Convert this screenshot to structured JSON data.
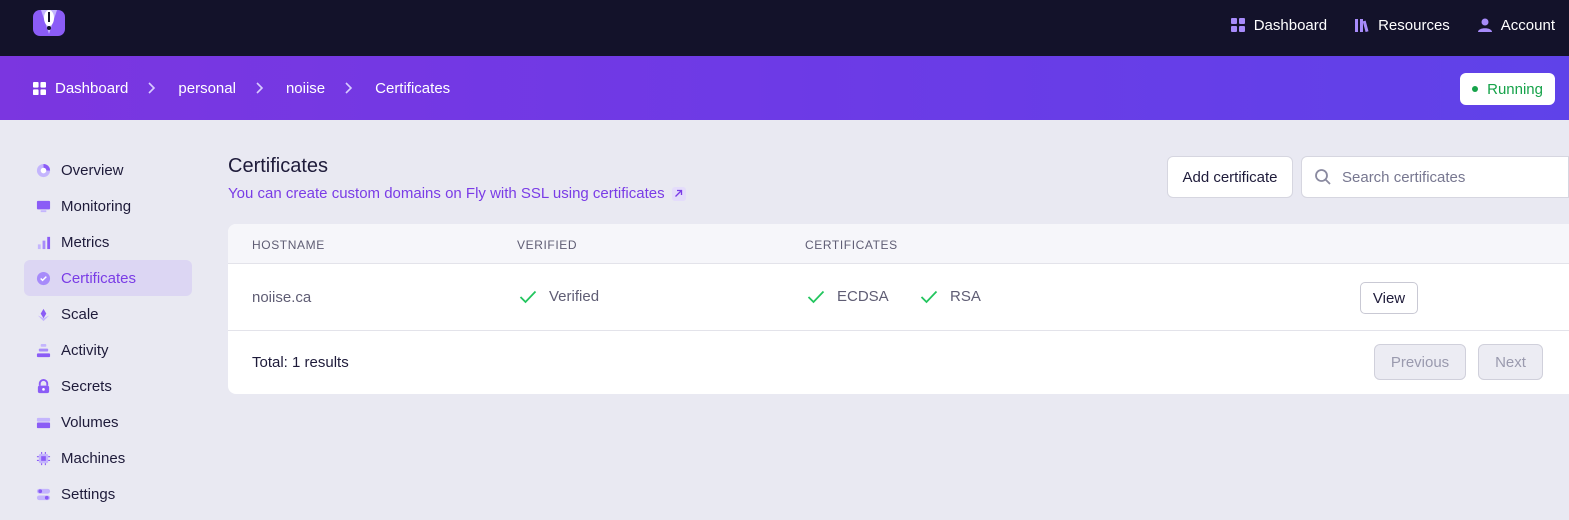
{
  "topnav": {
    "dashboard": "Dashboard",
    "resources": "Resources",
    "account": "Account"
  },
  "breadcrumb": {
    "items": [
      "Dashboard",
      "personal",
      "noiise",
      "Certificates"
    ]
  },
  "status": {
    "label": "Running",
    "color": "#16a34a"
  },
  "sidebar": {
    "items": [
      {
        "label": "Overview",
        "icon": "overview-icon"
      },
      {
        "label": "Monitoring",
        "icon": "monitor-icon"
      },
      {
        "label": "Metrics",
        "icon": "metrics-icon"
      },
      {
        "label": "Certificates",
        "icon": "certificate-icon",
        "active": true
      },
      {
        "label": "Scale",
        "icon": "scale-icon"
      },
      {
        "label": "Activity",
        "icon": "activity-icon"
      },
      {
        "label": "Secrets",
        "icon": "lock-icon"
      },
      {
        "label": "Volumes",
        "icon": "volume-icon"
      },
      {
        "label": "Machines",
        "icon": "chip-icon"
      },
      {
        "label": "Settings",
        "icon": "settings-icon"
      }
    ]
  },
  "main": {
    "title": "Certificates",
    "subtitle": "You can create custom domains on Fly with SSL using certificates",
    "add_button": "Add certificate",
    "search_placeholder": "Search certificates"
  },
  "table": {
    "columns": [
      "HOSTNAME",
      "VERIFIED",
      "CERTIFICATES"
    ],
    "rows": [
      {
        "hostname": "noiise.ca",
        "verified": "Verified",
        "certs": [
          "ECDSA",
          "RSA"
        ],
        "action": "View"
      }
    ],
    "total": "Total: 1 results",
    "previous": "Previous",
    "next": "Next"
  },
  "colors": {
    "accent": "#7a3ce6",
    "topbar": "#13122a",
    "check": "#22c55e"
  }
}
